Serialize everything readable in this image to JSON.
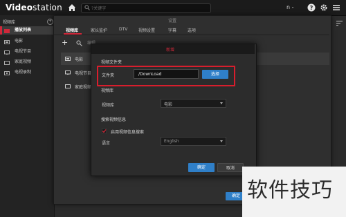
{
  "app": {
    "logo_bold": "Video",
    "logo_light": "station"
  },
  "topbar": {
    "search_placeholder": "?关键字",
    "user_label": "n -"
  },
  "sidebar": {
    "title": "视频库",
    "add_label": "+",
    "items": [
      {
        "label": "播放列表",
        "icon": "playlist-icon",
        "active": true
      },
      {
        "label": "电影",
        "icon": "movie-icon"
      },
      {
        "label": "电视节目",
        "icon": "tv-icon"
      },
      {
        "label": "家庭视频",
        "icon": "home-video-icon"
      },
      {
        "label": "电视录制",
        "icon": "recording-icon"
      }
    ]
  },
  "settings": {
    "title": "设置",
    "tabs": [
      {
        "label": "视频库",
        "active": true
      },
      {
        "label": "家长监护"
      },
      {
        "label": "DTV"
      },
      {
        "label": "视频设置"
      },
      {
        "label": "字幕"
      },
      {
        "label": "选项"
      }
    ],
    "add_button": "+",
    "edit_label": "编辑",
    "libraries": [
      {
        "label": "电影",
        "icon": "movie-icon"
      },
      {
        "label": "电视节目",
        "icon": "tv-icon"
      },
      {
        "label": "家庭视频",
        "icon": "home-video-icon"
      }
    ],
    "confirm_label": "确定"
  },
  "modal": {
    "title": "新增",
    "section_folder": "视频文件夹",
    "folder_label": "文件夹",
    "folder_value": "/DownLoad",
    "browse_label": "选择",
    "section_library": "视频库",
    "library_label": "视频库",
    "library_value": "电影",
    "section_search": "搜索视频信息",
    "checkbox_label": "启用视频信息搜索",
    "checkbox_checked": true,
    "language_label": "语言",
    "language_value": "English",
    "ok_label": "确定",
    "cancel_label": "取消"
  },
  "watermark": "软件技巧",
  "colors": {
    "accent_red": "#d0283a",
    "primary_blue": "#2f7fc8",
    "background": "#2b2b2b"
  }
}
